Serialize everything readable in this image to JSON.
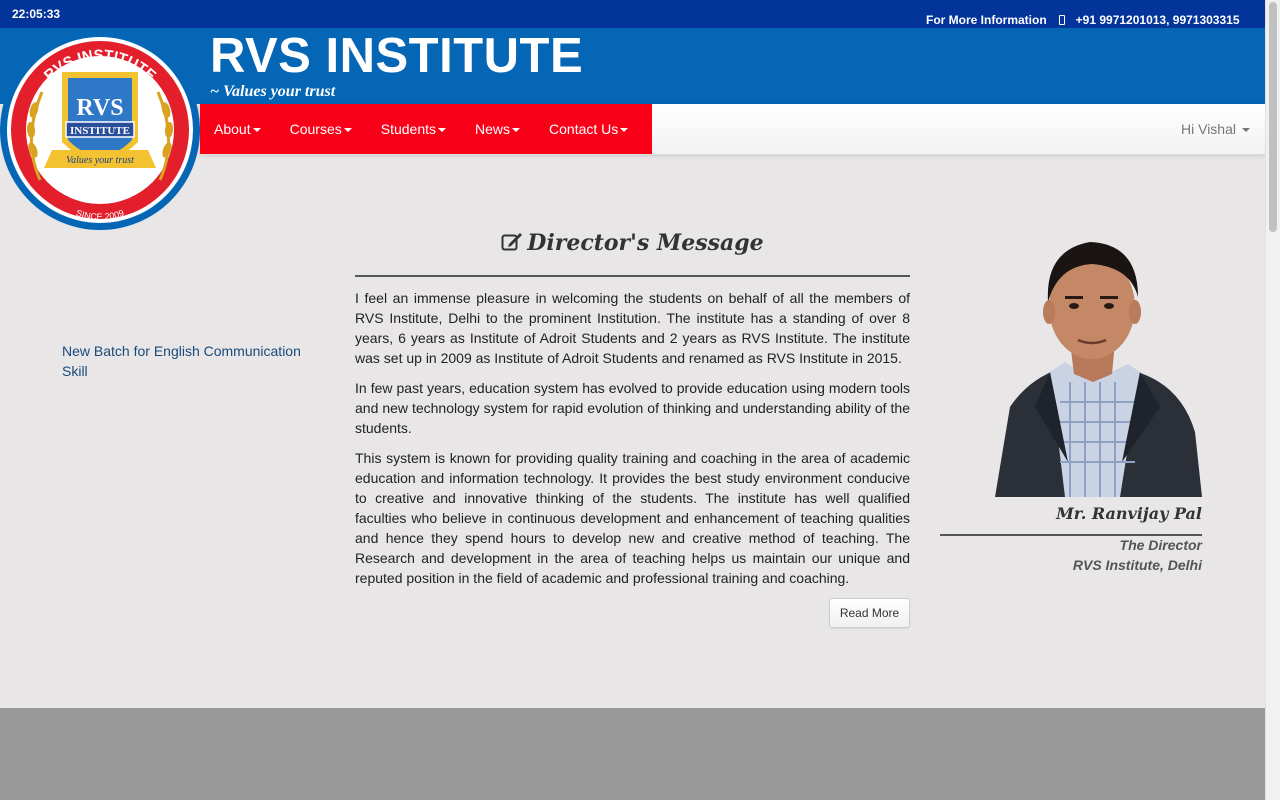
{
  "topbar": {
    "clock": "22:05:33",
    "info_label": "For More Information",
    "phone": "+91 9971201013, 9971303315"
  },
  "brand": {
    "title": "RVS INSTITUTE",
    "tagline": "~ Values your trust",
    "logo_arc_text": "RVS INSTITUTE",
    "logo_monogram": "RVS",
    "logo_sub": "INSTITUTE",
    "logo_ribbon": "Values your trust",
    "logo_since": "SINCE 2009"
  },
  "nav": {
    "items": [
      {
        "label": "About"
      },
      {
        "label": "Courses"
      },
      {
        "label": "Students"
      },
      {
        "label": "News"
      },
      {
        "label": "Contact Us"
      }
    ],
    "user": "Hi Vishal"
  },
  "news": {
    "link": "New Batch for English Communication Skill"
  },
  "message": {
    "heading": "Director's Message",
    "paragraphs": [
      "I feel an immense pleasure in welcoming the students on behalf of all the members of RVS Institute, Delhi to the prominent Institution. The institute has a standing of over 8 years, 6 years as Institute of Adroit Students and 2 years as RVS Institute. The institute was set up in 2009 as Institute of Adroit Students and renamed as RVS Institute in 2015.",
      "In few past years, education system has evolved to provide education using modern tools and new technology system for rapid evolution of thinking and understanding ability of the students.",
      "This system is known for providing quality training and coaching in the area of academic education and information technology. It provides the best study environment conducive to creative and innovative thinking of the students. The institute has well qualified faculties who believe in continuous development and enhancement of teaching qualities and hence they spend hours to develop new and creative method of teaching. The Research and development in the area of teaching helps us maintain our unique and reputed position in the field of academic and professional training and coaching."
    ],
    "read_more": "Read More"
  },
  "director": {
    "name": "Mr. Ranvijay Pal",
    "role": "The Director",
    "org": "RVS Institute, Delhi"
  },
  "colors": {
    "topbar": "#03349a",
    "brand": "#0466b5",
    "nav_red": "#f90019",
    "page_bg": "#e8e6e7",
    "footer": "#999999"
  }
}
